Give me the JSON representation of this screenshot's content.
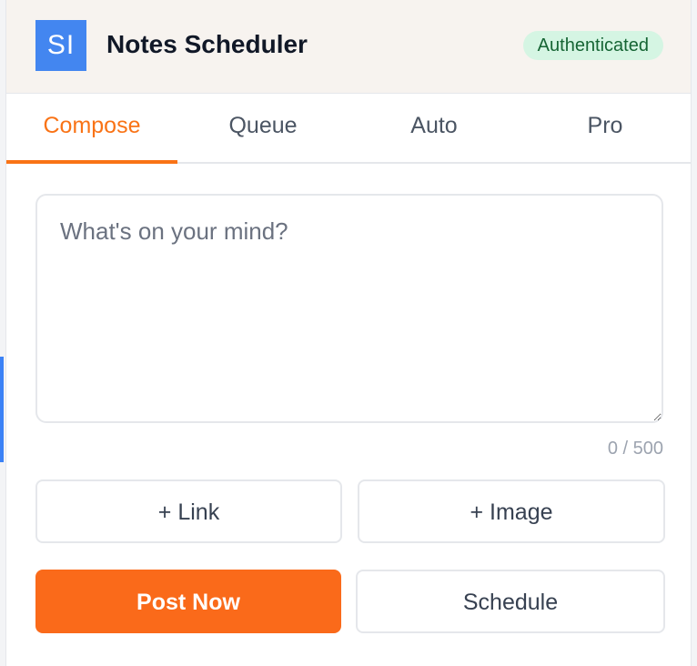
{
  "app": {
    "logo_text": "SI",
    "title": "Notes Scheduler",
    "status_badge": "Authenticated"
  },
  "tabs": [
    {
      "label": "Compose",
      "active": true
    },
    {
      "label": "Queue",
      "active": false
    },
    {
      "label": "Auto",
      "active": false
    },
    {
      "label": "Pro",
      "active": false
    }
  ],
  "compose": {
    "note_value": "",
    "note_placeholder": "What's on your mind?",
    "char_count": "0 / 500",
    "add_link_label": "+ Link",
    "add_image_label": "+ Image",
    "post_now_label": "Post Now",
    "schedule_label": "Schedule"
  },
  "colors": {
    "accent": "#fa6a1a",
    "logo": "#4386f0",
    "badge_bg": "#d5f5e3",
    "badge_text": "#166534",
    "header_bg": "#f7f3ef"
  }
}
